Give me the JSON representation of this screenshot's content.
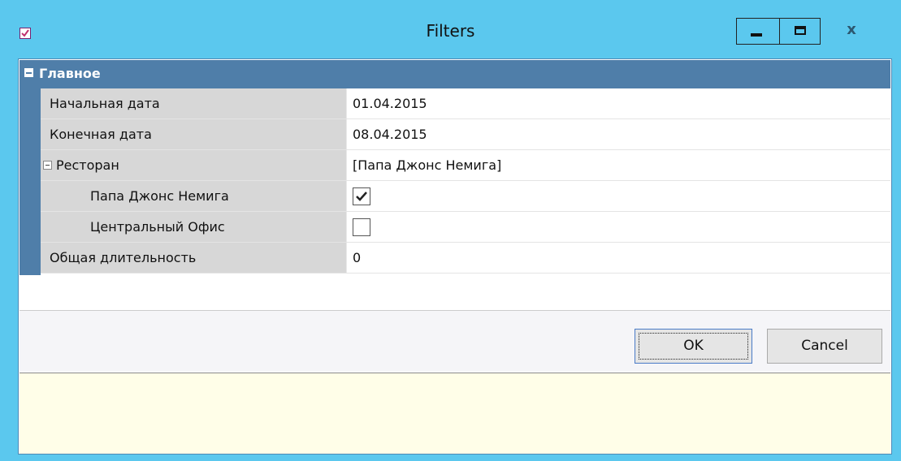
{
  "window": {
    "title": "Filters",
    "app_icon": "checkbox-icon",
    "minimize_icon": "minimize-icon",
    "maximize_icon": "maximize-icon",
    "close_label": "x"
  },
  "grid": {
    "category": {
      "label": "Главное",
      "toggle_icon": "collapse-icon"
    },
    "rows": [
      {
        "name": "Начальная дата",
        "value": "01.04.2015"
      },
      {
        "name": "Конечная дата",
        "value": "08.04.2015"
      },
      {
        "name": "Ресторан",
        "value": "[Папа Джонс Немига]",
        "toggle_icon": "collapse-icon"
      },
      {
        "name": "Папа Джонс Немига",
        "checked": true
      },
      {
        "name": "Центральный Офис",
        "checked": false
      },
      {
        "name": "Общая длительность",
        "value": "0"
      }
    ]
  },
  "buttons": {
    "ok": "OK",
    "cancel": "Cancel"
  },
  "colors": {
    "titlebar": "#5bc8ee",
    "category": "#4f7ea9",
    "description_bg": "#fffee8"
  }
}
